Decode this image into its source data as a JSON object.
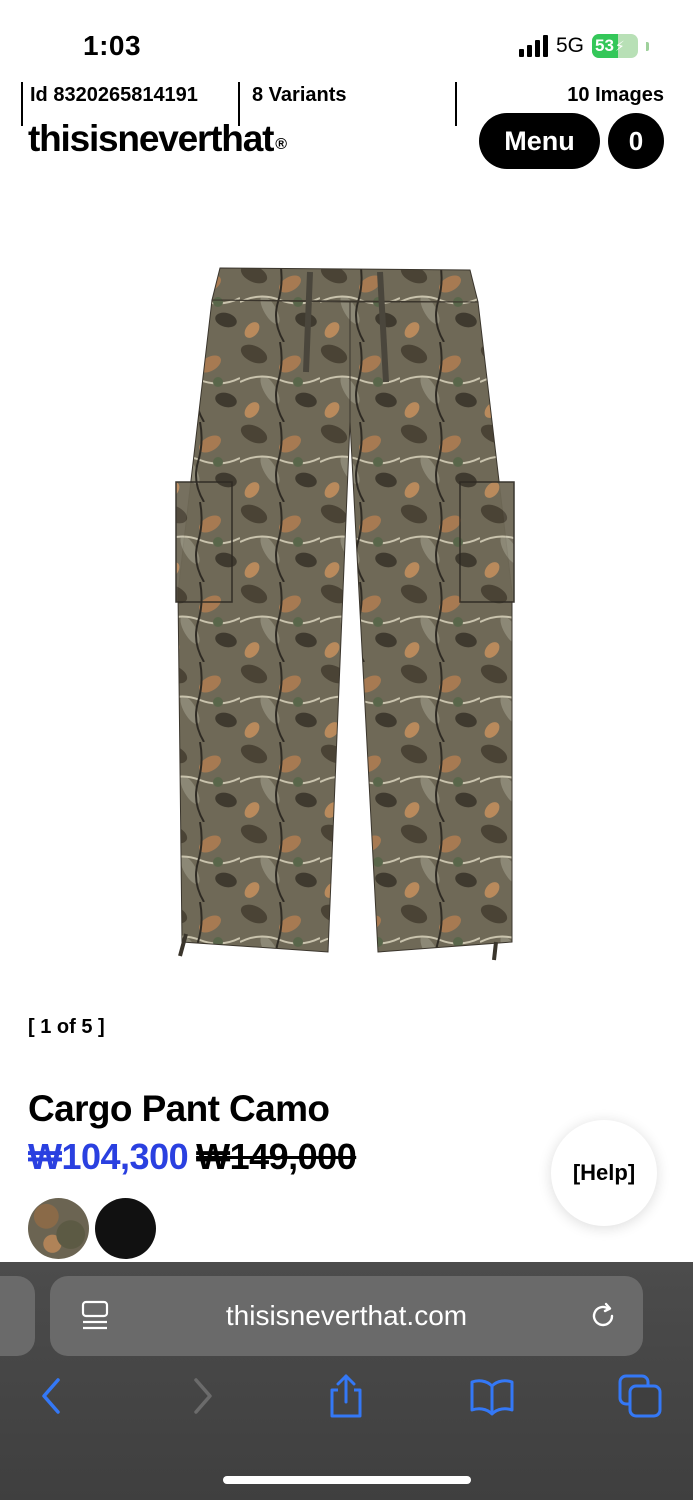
{
  "status": {
    "time": "1:03",
    "network": "5G",
    "battery": "53"
  },
  "header": {
    "product_id": "Id 8320265814191",
    "variants": "8 Variants",
    "images": "10 Images",
    "brand": "thisisneverthat",
    "brand_mark": "®",
    "menu_label": "Menu",
    "cart_count": "0"
  },
  "gallery": {
    "counter": "[ 1 of 5 ]"
  },
  "product": {
    "title": "Cargo Pant Camo",
    "sale_price": "₩104,300",
    "original_price": "₩149,000",
    "swatches": [
      "camo",
      "black"
    ]
  },
  "help": {
    "label": "[Help]"
  },
  "browser": {
    "url": "thisisneverthat.com",
    "toolbar_icons": [
      "back-icon",
      "forward-icon",
      "share-icon",
      "bookmarks-icon",
      "tabs-icon"
    ]
  },
  "colors": {
    "accent_price": "#2a40e0",
    "browser_bg": "#444444",
    "pill_bg": "#6a6a6a",
    "safari_blue": "#3478f6"
  }
}
